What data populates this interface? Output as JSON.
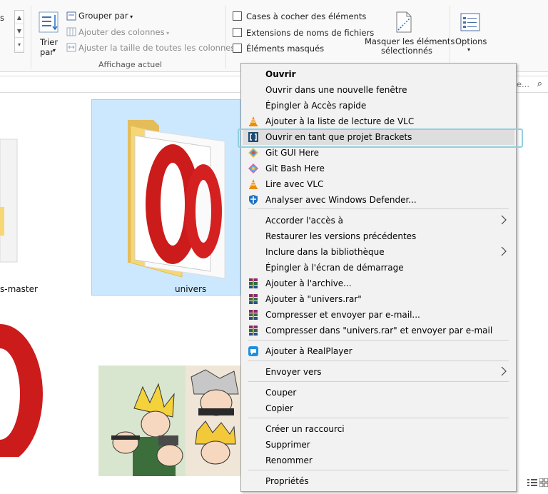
{
  "ribbon": {
    "group_by": "Grouper par",
    "add_columns": "Ajouter des colonnes",
    "fit_columns": "Ajuster la taille de toutes les colonnes",
    "sort_by_line1": "Trier",
    "sort_by_line2": "par",
    "current_view_label": "Affichage actuel",
    "checkboxes_label": "Cases à cocher des éléments",
    "extensions_label": "Extensions de noms de fichiers",
    "hidden_items_label": "Éléments masqués",
    "hide_selected_line1": "Masquer les éléments",
    "hide_selected_line2": "sélectionnés",
    "options_label": "Options",
    "partial_left_text": "s"
  },
  "search": {
    "placeholder": "ge..."
  },
  "files": {
    "left_item_label": "s-master",
    "selected_item_label": "univers"
  },
  "context_menu": {
    "items": [
      {
        "label": "Ouvrir",
        "bold": true,
        "icon": ""
      },
      {
        "label": "Ouvrir dans une nouvelle fenêtre",
        "icon": ""
      },
      {
        "label": "Épingler à Accès rapide",
        "icon": ""
      },
      {
        "label": "Ajouter à la liste de lecture de VLC",
        "icon": "vlc-icon"
      },
      {
        "label": "Ouvrir en tant que projet Brackets",
        "icon": "brackets-icon",
        "highlighted": true
      },
      {
        "label": "Git GUI Here",
        "icon": "git-gui-icon"
      },
      {
        "label": "Git Bash Here",
        "icon": "git-bash-icon"
      },
      {
        "label": "Lire avec VLC",
        "icon": "vlc-icon"
      },
      {
        "label": "Analyser avec Windows Defender...",
        "icon": "windows-defender-icon"
      },
      {
        "label": "Accorder l'accès à",
        "submenu": true,
        "icon": ""
      },
      {
        "label": "Restaurer les versions précédentes",
        "icon": ""
      },
      {
        "label": "Inclure dans la bibliothèque",
        "submenu": true,
        "icon": ""
      },
      {
        "label": "Épingler à l'écran de démarrage",
        "icon": ""
      },
      {
        "label": "Ajouter à l'archive...",
        "icon": "winrar-icon"
      },
      {
        "label": "Ajouter à \"univers.rar\"",
        "icon": "winrar-icon"
      },
      {
        "label": "Compresser et envoyer par e-mail...",
        "icon": "winrar-icon"
      },
      {
        "label": "Compresser dans \"univers.rar\" et envoyer par e-mail",
        "icon": "winrar-icon"
      },
      {
        "label": "Ajouter à RealPlayer",
        "icon": "realplayer-icon"
      },
      {
        "label": "Envoyer vers",
        "submenu": true,
        "icon": ""
      },
      {
        "label": "Couper",
        "icon": ""
      },
      {
        "label": "Copier",
        "icon": ""
      },
      {
        "label": "Créer un raccourci",
        "icon": ""
      },
      {
        "label": "Supprimer",
        "icon": ""
      },
      {
        "label": "Renommer",
        "icon": ""
      },
      {
        "label": "Propriétés",
        "icon": ""
      }
    ]
  },
  "colors": {
    "selection_bg": "#cce8ff",
    "menu_bg": "#f2f2f2",
    "highlight_ring": "#8fd0e0",
    "opera_red": "#cc1b1b",
    "folder_yellow": "#f7d774"
  }
}
